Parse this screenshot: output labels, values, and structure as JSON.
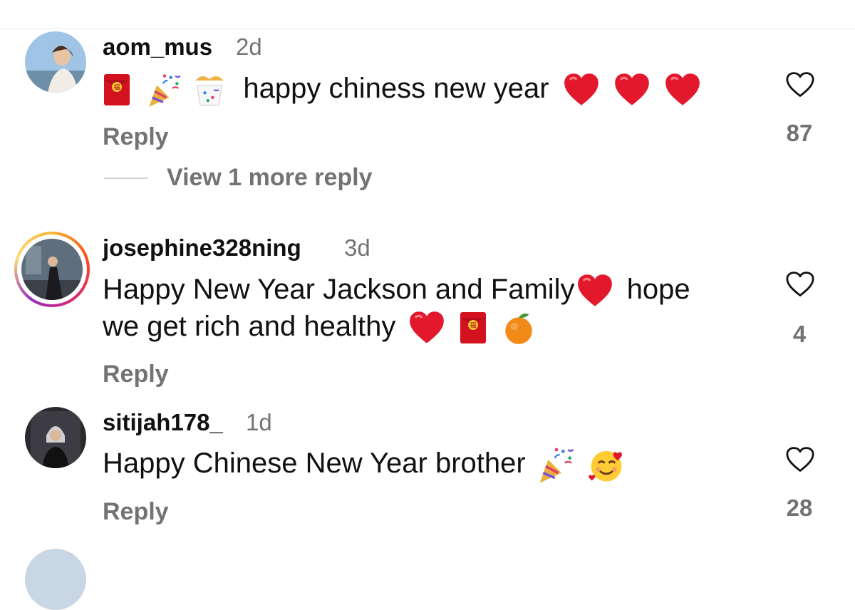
{
  "comments": [
    {
      "username": "aom_mus",
      "age": "2d",
      "text": "happy chiness new year",
      "reply_label": "Reply",
      "likes": "87",
      "view_more": "View 1 more reply"
    },
    {
      "username": "josephine328ning",
      "age": "3d",
      "text_line1": "Happy New Year Jackson and Family",
      "text_line1_tail": "hope",
      "text_line2": "we get rich and healthy",
      "reply_label": "Reply",
      "likes": "4"
    },
    {
      "username": "sitijah178_",
      "age": "1d",
      "text": "Happy Chinese New Year brother",
      "reply_label": "Reply",
      "likes": "28"
    }
  ],
  "icons": {
    "like": "heart-outline-icon",
    "red_envelope": "red-envelope-emoji",
    "party_popper": "party-popper-emoji",
    "heart": "red-heart-emoji",
    "tangerine": "tangerine-emoji",
    "smiling_hearts": "smiling-face-with-hearts-emoji"
  },
  "colors": {
    "text_primary": "#111111",
    "text_secondary": "#737373",
    "heart_red": "#e3182d",
    "story_ring": "#d62976"
  }
}
